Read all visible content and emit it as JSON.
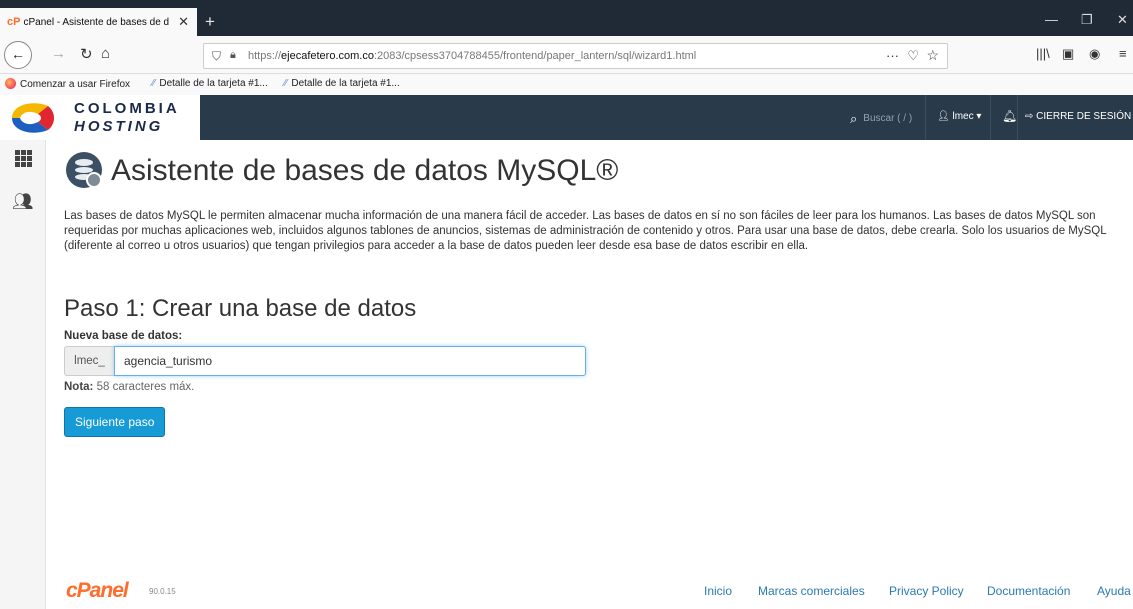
{
  "browser": {
    "tab_title": "cPanel - Asistente de bases de d",
    "tab_close": "✕",
    "new_tab": "+",
    "url_prefix": "https://",
    "url_host": "ejecafetero.com.co",
    "url_rest": ":2083/cpsess3704788455/frontend/paper_lantern/sql/wizard1.html",
    "bookmarks": [
      "Comenzar a usar Firefox",
      "Detalle de la tarjeta #1...",
      "Detalle de la tarjeta #1..."
    ]
  },
  "header": {
    "logo_line1": "COLOMBIA",
    "logo_line2": "HOSTING",
    "search_placeholder": "Buscar ( / )",
    "user": "lmec",
    "logout": "CIERRE DE SESIÓN"
  },
  "page": {
    "title": "Asistente de bases de datos MySQL®",
    "description": "Las bases de datos MySQL le permiten almacenar mucha información de una manera fácil de acceder. Las bases de datos en sí no son fáciles de leer para los humanos. Las bases de datos MySQL son requeridas por muchas aplicaciones web, incluidos algunos tablones de anuncios, sistemas de administración de contenido y otros. Para usar una base de datos, debe crearla. Solo los usuarios de MySQL (diferente al correo u otros usuarios) que tengan privilegios para acceder a la base de datos pueden leer desde esa base de datos escribir en ella.",
    "step_title": "Paso 1: Crear una base de datos",
    "field_label": "Nueva base de datos:",
    "prefix": "lmec_",
    "db_value": "agencia_turismo",
    "note_bold": "Nota:",
    "note_text": " 58 caracteres máx.",
    "next_button": "Siguiente paso"
  },
  "footer": {
    "brand": "cPanel",
    "version": "90.0.15",
    "links": [
      "Inicio",
      "Marcas comerciales",
      "Privacy Policy",
      "Documentación",
      "Ayuda"
    ]
  },
  "colors": {
    "browser_dark": "#1f2a36",
    "cpanel_header": "#293a4a",
    "primary_button": "#179bd7",
    "cpanel_orange": "#ff6c2c",
    "link": "#2a7ab0"
  }
}
